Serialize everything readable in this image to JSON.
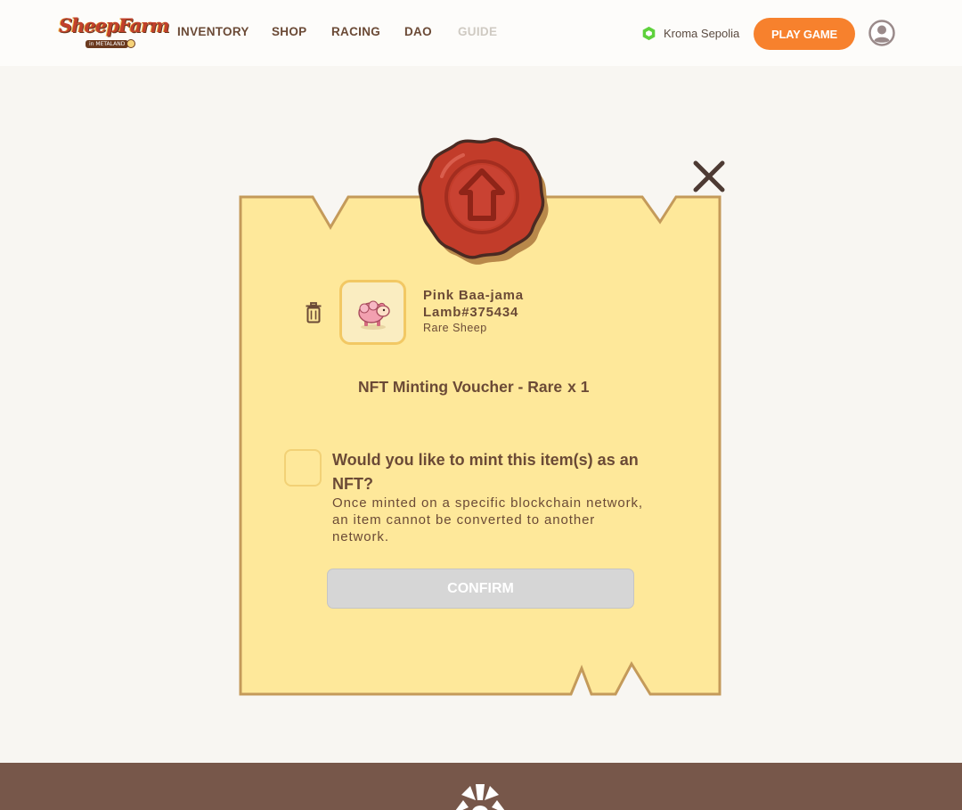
{
  "brand": {
    "logo_text": "SheepFarm",
    "logo_sub": "in METALAND"
  },
  "nav": {
    "items": [
      {
        "label": "INVENTORY"
      },
      {
        "label": "SHOP"
      },
      {
        "label": "RACING"
      },
      {
        "label": "DAO"
      },
      {
        "label": "GUIDE"
      }
    ]
  },
  "header": {
    "network_label": "Kroma Sepolia",
    "network_icon": "kroma-network-icon",
    "play_button_label": "PLAY GAME",
    "avatar_icon": "user-avatar-icon"
  },
  "modal": {
    "seal_icon": "wax-seal-up-arrow-icon",
    "close_icon": "close-icon",
    "item": {
      "name": "Pink Baa-jama Lamb#375434",
      "rarity": "Rare Sheep",
      "image_icon": "pink-sheep-icon",
      "delete_icon": "trash-icon"
    },
    "voucher": {
      "label": "NFT Minting Voucher - Rare",
      "quantity": "x 1"
    },
    "mint_option": {
      "checked": false,
      "question": "Would you like to mint this item(s) as an NFT?",
      "note": "Once minted on a specific blockchain network, an item cannot be converted to another network."
    },
    "confirm_label": "CONFIRM"
  },
  "colors": {
    "accent": "#f7812d",
    "modal_fill": "#fee89a",
    "modal_border": "#c49a5a",
    "text_brown": "#6b4a36",
    "footer": "#77574a",
    "seal_red": "#c0392b",
    "disabled_button": "#d6d6d6"
  }
}
